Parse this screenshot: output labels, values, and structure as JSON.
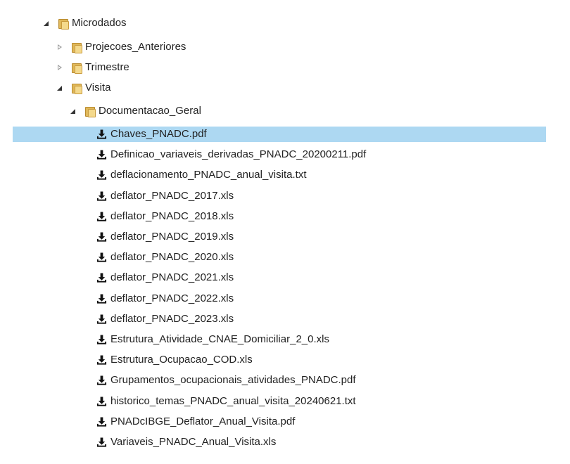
{
  "tree": {
    "folders": [
      {
        "label": "Microdados",
        "state": "expanded"
      },
      {
        "label": "Projecoes_Anteriores",
        "state": "collapsed"
      },
      {
        "label": "Trimestre",
        "state": "collapsed"
      },
      {
        "label": "Visita",
        "state": "expanded"
      },
      {
        "label": "Documentacao_Geral",
        "state": "expanded"
      }
    ],
    "files": [
      {
        "label": "Chaves_PNADC.pdf",
        "selected": true
      },
      {
        "label": "Definicao_variaveis_derivadas_PNADC_20200211.pdf"
      },
      {
        "label": "deflacionamento_PNADC_anual_visita.txt"
      },
      {
        "label": "deflator_PNADC_2017.xls"
      },
      {
        "label": "deflator_PNADC_2018.xls"
      },
      {
        "label": "deflator_PNADC_2019.xls"
      },
      {
        "label": "deflator_PNADC_2020.xls"
      },
      {
        "label": "deflator_PNADC_2021.xls"
      },
      {
        "label": "deflator_PNADC_2022.xls"
      },
      {
        "label": "deflator_PNADC_2023.xls"
      },
      {
        "label": "Estrutura_Atividade_CNAE_Domiciliar_2_0.xls"
      },
      {
        "label": "Estrutura_Ocupacao_COD.xls"
      },
      {
        "label": "Grupamentos_ocupacionais_atividades_PNADC.pdf"
      },
      {
        "label": "historico_temas_PNADC_anual_visita_20240621.txt"
      },
      {
        "label": "PNADcIBGE_Deflator_Anual_Visita.pdf"
      },
      {
        "label": "Variaveis_PNADC_Anual_Visita.xls"
      }
    ]
  },
  "colors": {
    "selection": "#add8f2",
    "folder": "#e0b85a",
    "text": "#222222",
    "icon": "#111111"
  },
  "icons": {
    "folder": "folder-icon",
    "download": "download-icon",
    "expand": "expand-arrow-icon",
    "collapse": "collapse-arrow-icon"
  }
}
